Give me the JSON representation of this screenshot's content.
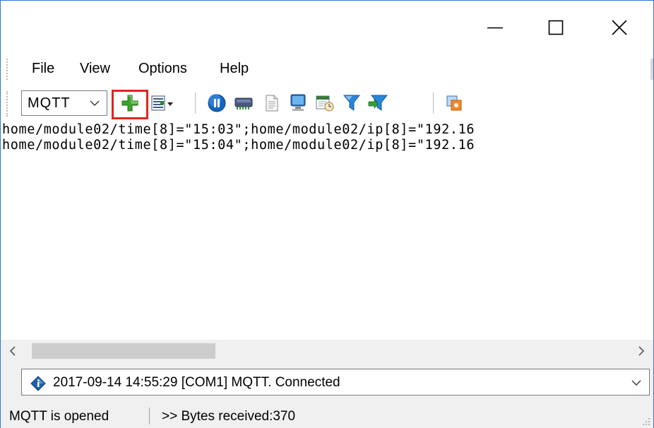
{
  "window": {
    "controls": {
      "minimize": "minimize-icon",
      "maximize": "maximize-icon",
      "close": "close-icon"
    }
  },
  "menu": {
    "items": [
      "File",
      "View",
      "Options",
      "Help"
    ]
  },
  "toolbar": {
    "protocol_select": {
      "value": "MQTT"
    },
    "buttons": [
      "add-icon",
      "view-options-icon",
      "pause-icon",
      "serial-port-icon",
      "document-icon",
      "computer-icon",
      "scheduler-icon",
      "filter-icon",
      "filter-apply-icon",
      "settings-icon"
    ],
    "highlight_color": "#e0251f"
  },
  "log": {
    "lines": [
      "home/module02/time[8]=\"15:03\";home/module02/ip[8]=\"192.16",
      "home/module02/time[8]=\"15:04\";home/module02/ip[8]=\"192.16"
    ]
  },
  "event_log": {
    "selected": "2017-09-14 14:55:29 [COM1] MQTT. Connected"
  },
  "status": {
    "state": "MQTT is opened",
    "bytes": ">> Bytes received:370"
  }
}
